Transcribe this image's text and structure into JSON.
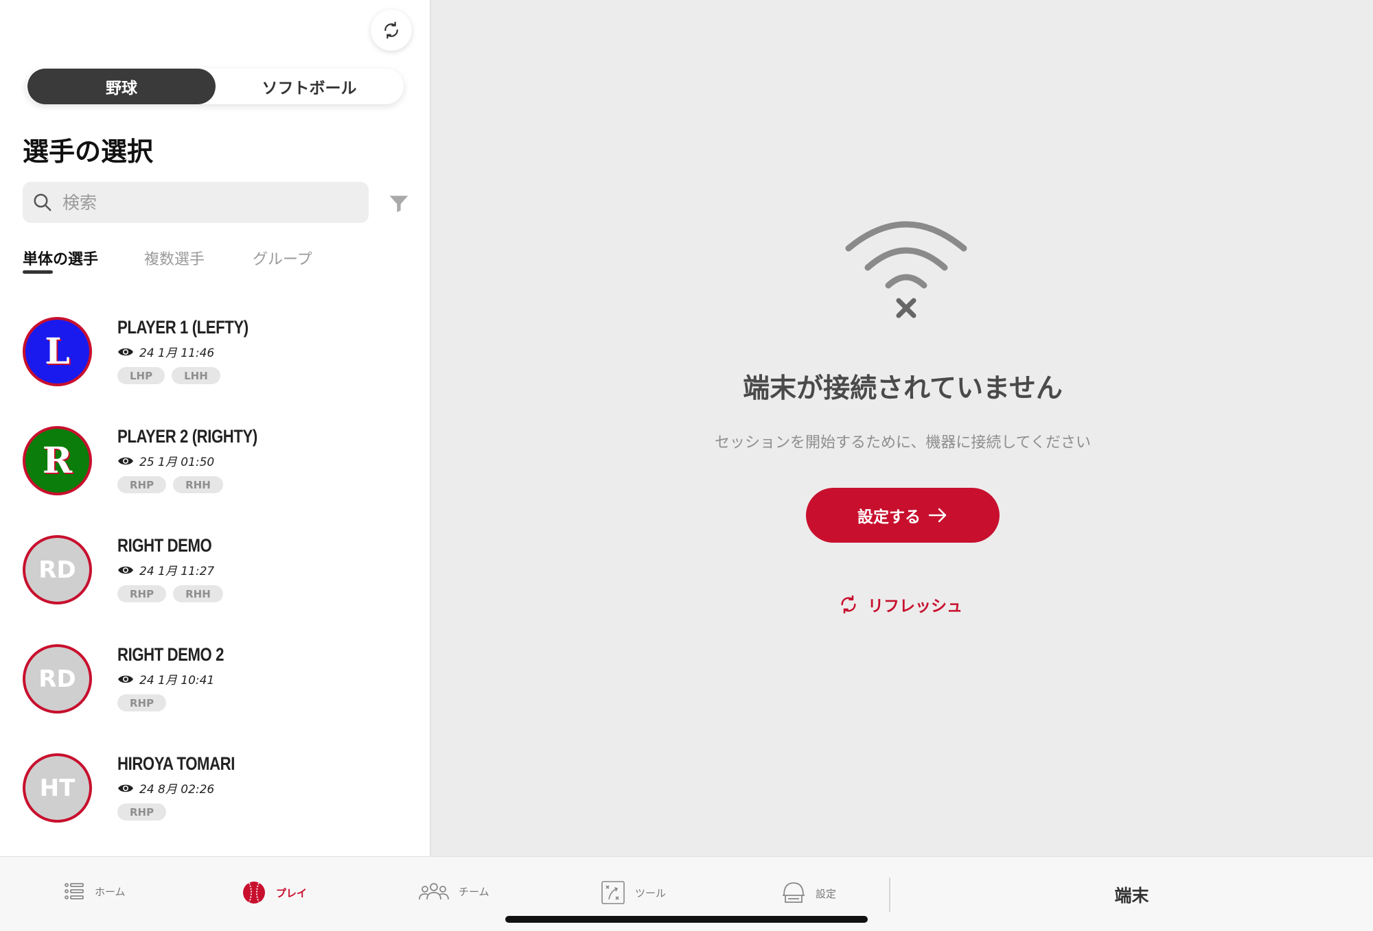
{
  "colors": {
    "accent": "#c8102e",
    "toggle_active": "#3a3a3a"
  },
  "sport_toggle": {
    "baseball": "野球",
    "softball": "ソフトボール"
  },
  "heading": "選手の選択",
  "search": {
    "placeholder": "検索"
  },
  "tabs": [
    {
      "label": "単体の選手"
    },
    {
      "label": "複数選手"
    },
    {
      "label": "グループ"
    }
  ],
  "players": [
    {
      "avatar_text": "L",
      "avatar_color": "#1a1aee",
      "name": "PLAYER 1 (LEFTY)",
      "date": "24 1月 11:46",
      "badges": [
        "LHP",
        "LHH"
      ]
    },
    {
      "avatar_text": "R",
      "avatar_color": "#0a7d0a",
      "name": "PLAYER 2 (RIGHTY)",
      "date": "25 1月 01:50",
      "badges": [
        "RHP",
        "RHH"
      ]
    },
    {
      "avatar_text": "RD",
      "avatar_color": "#cfcfcf",
      "name": "RIGHT DEMO",
      "date": "24 1月 11:27",
      "badges": [
        "RHP",
        "RHH"
      ]
    },
    {
      "avatar_text": "RD",
      "avatar_color": "#cfcfcf",
      "name": "RIGHT DEMO 2",
      "date": "24 1月 10:41",
      "badges": [
        "RHP"
      ]
    },
    {
      "avatar_text": "HT",
      "avatar_color": "#cfcfcf",
      "name": "HIROYA TOMARI",
      "date": "24 8月 02:26",
      "badges": [
        "RHP"
      ]
    }
  ],
  "empty_state": {
    "title": "端末が接続されていません",
    "description": "セッションを開始するために、機器に接続してください",
    "setup_label": "設定する",
    "refresh_label": "リフレッシュ"
  },
  "bottom_nav": {
    "home": "ホーム",
    "play": "プレイ",
    "team": "チーム",
    "tools": "ツール",
    "settings": "設定",
    "device": "端末"
  }
}
